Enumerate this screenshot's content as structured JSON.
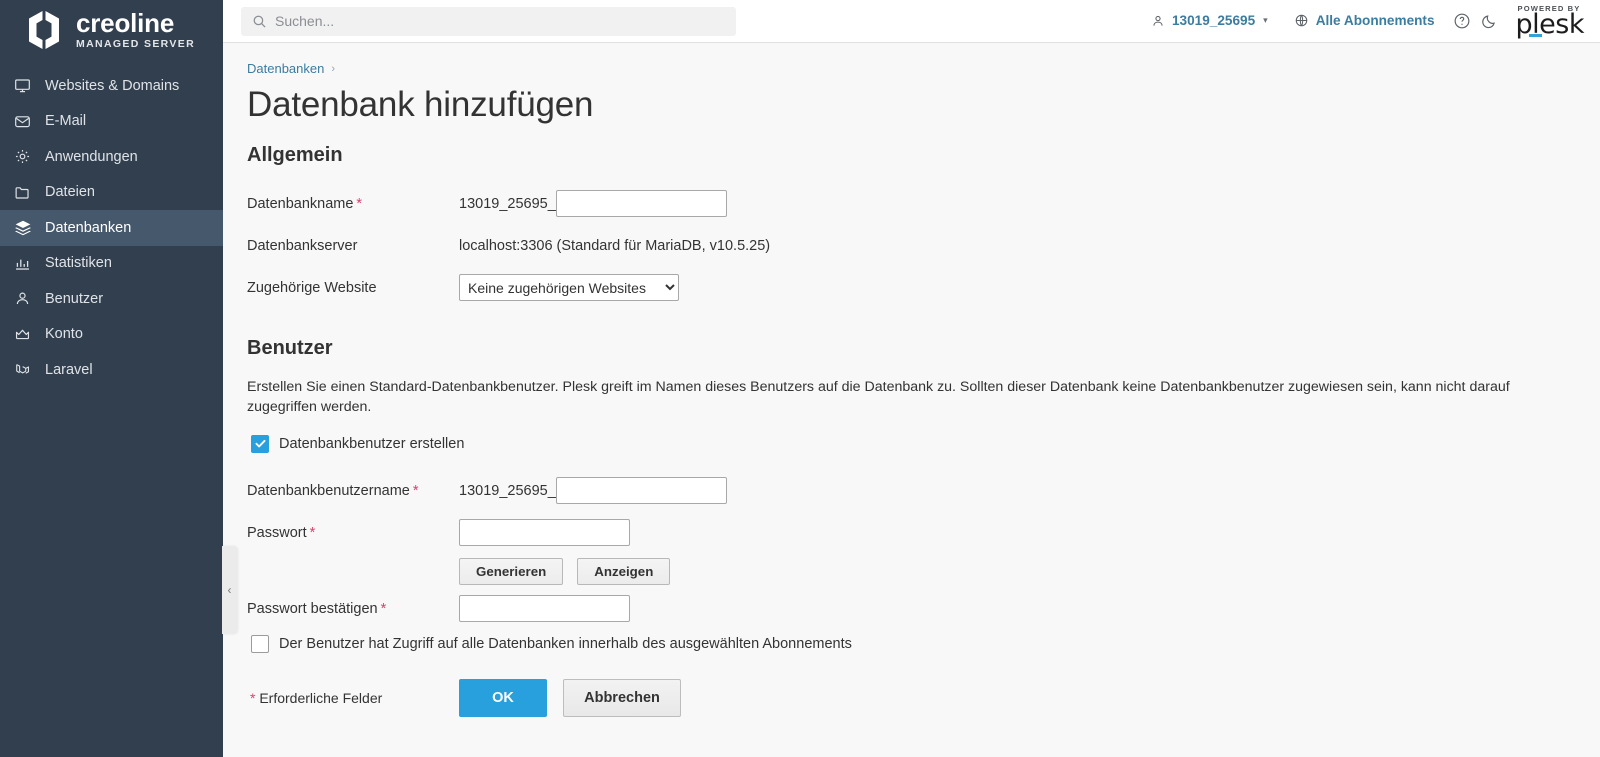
{
  "sidebar": {
    "logo": {
      "name": "creoline",
      "subtitle": "MANAGED SERVER"
    },
    "items": [
      {
        "label": "Websites & Domains",
        "icon": "monitor-icon",
        "active": false
      },
      {
        "label": "E-Mail",
        "icon": "envelope-icon",
        "active": false
      },
      {
        "label": "Anwendungen",
        "icon": "gear-icon",
        "active": false
      },
      {
        "label": "Dateien",
        "icon": "folder-icon",
        "active": false
      },
      {
        "label": "Datenbanken",
        "icon": "database-layers-icon",
        "active": true
      },
      {
        "label": "Statistiken",
        "icon": "bar-chart-icon",
        "active": false
      },
      {
        "label": "Benutzer",
        "icon": "user-icon",
        "active": false
      },
      {
        "label": "Konto",
        "icon": "crown-icon",
        "active": false
      },
      {
        "label": "Laravel",
        "icon": "laravel-icon",
        "active": false
      }
    ],
    "collapse_glyph": "‹"
  },
  "header": {
    "search": {
      "placeholder": "Suchen...",
      "value": "",
      "icon": "search-icon"
    },
    "account": {
      "label": "13019_25695",
      "icon": "user-icon",
      "caret": "⌄"
    },
    "subscriptions": {
      "label": "Alle Abonnements",
      "icon": "globe-icon"
    },
    "help_icon": "help-circle-icon",
    "theme_icon": "moon-icon",
    "plesk": {
      "powered_by": "POWERED BY",
      "wordmark": "plesk",
      "accent": "#31a3d9"
    }
  },
  "breadcrumb": {
    "item": "Datenbanken",
    "separator": "›"
  },
  "page": {
    "title": "Datenbank hinzufügen",
    "general": {
      "heading": "Allgemein",
      "db_name": {
        "label": "Datenbankname",
        "required_marker": "*",
        "prefix": "13019_25695_",
        "value": ""
      },
      "db_server": {
        "label": "Datenbankserver",
        "value": "localhost:3306 (Standard für MariaDB, v10.5.25)"
      },
      "related_website": {
        "label": "Zugehörige Website",
        "selected": "Keine zugehörigen Websites",
        "options": [
          "Keine zugehörigen Websites"
        ]
      }
    },
    "user": {
      "heading": "Benutzer",
      "description": "Erstellen Sie einen Standard-Datenbankbenutzer. Plesk greift im Namen dieses Benutzers auf die Datenbank zu. Sollten dieser Datenbank keine Datenbankbenutzer zugewiesen sein, kann nicht darauf zugegriffen werden.",
      "create_user_checkbox": {
        "label": "Datenbankbenutzer erstellen",
        "checked": true
      },
      "db_username": {
        "label": "Datenbankbenutzername",
        "required_marker": "*",
        "prefix": "13019_25695_",
        "value": ""
      },
      "password": {
        "label": "Passwort",
        "required_marker": "*",
        "value": ""
      },
      "generate_button": "Generieren",
      "show_button": "Anzeigen",
      "password_confirm": {
        "label": "Passwort bestätigen",
        "required_marker": "*",
        "value": ""
      },
      "access_all_checkbox": {
        "label": "Der Benutzer hat Zugriff auf alle Datenbanken innerhalb des ausgewählten Abonnements",
        "checked": false
      }
    },
    "footer": {
      "required_note": "* Erforderliche Felder",
      "required_star": "*",
      "required_text": "Erforderliche Felder",
      "ok_button": "OK",
      "cancel_button": "Abbrechen"
    }
  }
}
